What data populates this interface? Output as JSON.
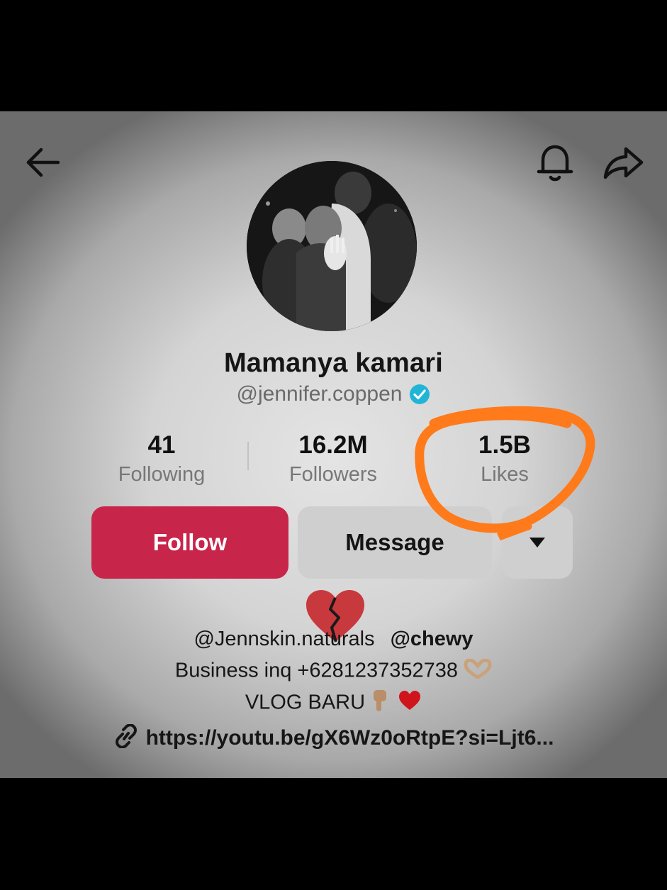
{
  "topbar": {
    "back_icon": "arrow-left-icon",
    "bell_icon": "bell-icon",
    "share_icon": "share-arrow-icon"
  },
  "profile": {
    "display_name": "Mamanya kamari",
    "username": "@jennifer.coppen",
    "verified": true
  },
  "stats": {
    "following": {
      "value": "41",
      "label": "Following"
    },
    "followers": {
      "value": "16.2M",
      "label": "Followers"
    },
    "likes": {
      "value": "1.5B",
      "label": "Likes"
    }
  },
  "actions": {
    "follow_label": "Follow",
    "message_label": "Message",
    "more_icon": "caret-down-icon"
  },
  "bio": {
    "mention_1": "@Jennskin.naturals",
    "mention_2": "@chewy",
    "business": "Business inq +6281237352738",
    "vlog": "VLOG BARU",
    "link": "https://youtu.be/gX6Wz0oRtpE?si=Ljt6..."
  },
  "colors": {
    "follow_button": "#c7254a",
    "secondary_button": "#cfcfcf",
    "verified_badge": "#20b5d6",
    "annotation_circle": "#ff7a1a"
  }
}
